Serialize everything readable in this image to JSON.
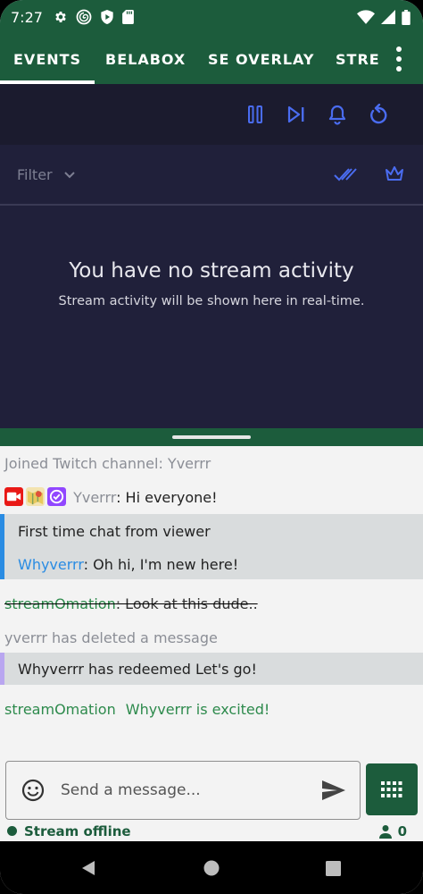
{
  "status_bar": {
    "time": "7:27"
  },
  "tabs": [
    {
      "label": "EVENTS"
    },
    {
      "label": "BELABOX"
    },
    {
      "label": "SE OVERLAY"
    },
    {
      "label": "STRE"
    }
  ],
  "events_panel": {
    "filter_label": "Filter",
    "empty_title": "You have no stream activity",
    "empty_subtitle": "Stream activity will be shown here in real-time."
  },
  "chat": {
    "joined": "Joined Twitch channel: Yverrr",
    "msg1_user": "Yverrr",
    "msg1_text": ": Hi everyone!",
    "first_time_header": "First time chat from viewer",
    "msg2_user": "Whyverrr",
    "msg2_text": ": Oh hi, I'm new here!",
    "msg3_user": "streamOmation",
    "msg3_text": ": Look at this dude..",
    "deleted_notice": "yverrr has deleted a message",
    "redeem_text": "Whyverrr has redeemed Let's go!",
    "msg4_user": "streamOmation",
    "msg4_text": "Whyverrr is excited!"
  },
  "composer": {
    "placeholder": "Send a message..."
  },
  "footer": {
    "stream_status": "Stream offline",
    "viewer_count": "0"
  },
  "colors": {
    "brand_green": "#1c5c3c",
    "accent_blue": "#3d5bd9",
    "first_time_bar": "#2a8ce3",
    "redeem_bar": "#b9a6f0"
  }
}
